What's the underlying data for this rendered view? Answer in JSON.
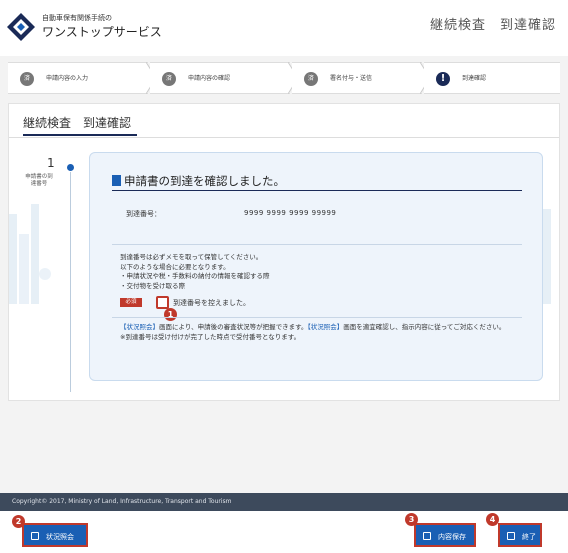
{
  "header": {
    "logo_small": "自動車保有関係手続の",
    "logo_main": "ワンストップサービス",
    "title": "継続検査　到達確認"
  },
  "steps": [
    {
      "status": "済",
      "label": "申請内容の入力"
    },
    {
      "status": "済",
      "label": "申請内容の確認"
    },
    {
      "status": "済",
      "label": "署名付与・送信"
    },
    {
      "status": "!",
      "label": "到達確認"
    }
  ],
  "main": {
    "tab_label": "継続検査　到達確認",
    "sidebar": {
      "number": "1",
      "label": "申請書の到達番号"
    },
    "card": {
      "title": "申請書の到達を確認しました。",
      "receipt_label": "到達番号：",
      "receipt_value": "9999 9999 9999 99999",
      "notes": [
        "到達番号は必ずメモを取って保管してください。",
        "以下のような場合に必要となります。",
        "・申請状況や税・手数料の納付の情報を確認する際",
        "・交付物を受け取る際"
      ],
      "required_label": "必須",
      "checkbox_label": "到達番号を控えました。",
      "info_link1": "【状況照会】",
      "info_text1": "画面により、申請後の審査状況等が把握できます。",
      "info_link2": "【状況照会】",
      "info_text2": "画面を適宜確認し、指示内容に従ってご対応ください。",
      "info_note": "※到達番号は受け付けが完了した時点で受付番号となります。"
    }
  },
  "footer": {
    "copyright": "Copyright© 2017, Ministry of Land, Infrastructure, Transport and Tourism"
  },
  "buttons": {
    "status": "状況照会",
    "save": "内容保存",
    "end": "終了"
  },
  "badges": [
    "1",
    "2",
    "3",
    "4"
  ],
  "colors": {
    "accent": "#1a5fb4",
    "navy": "#1a2a57",
    "alert": "#c0392b"
  }
}
